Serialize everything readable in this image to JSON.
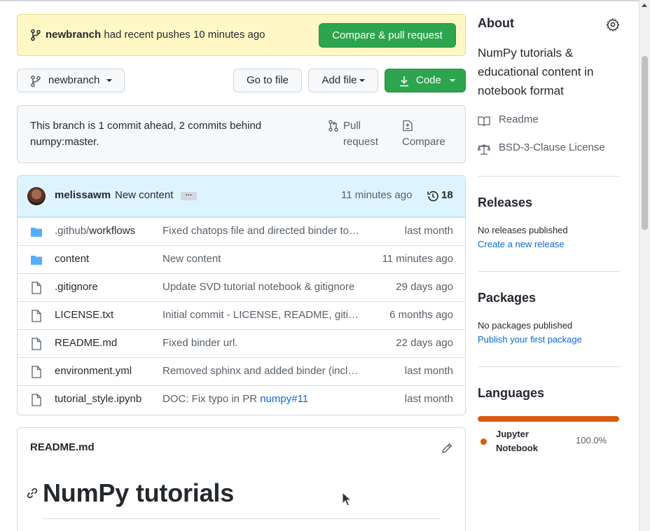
{
  "flash": {
    "branch": "newbranch",
    "message": "had recent pushes 10 minutes ago",
    "compare_button": "Compare & pull request"
  },
  "toolbar": {
    "branch_select": "newbranch",
    "go_to_file": "Go to file",
    "add_file": "Add file",
    "code": "Code"
  },
  "ahead_behind": {
    "text": "This branch is 1 commit ahead, 2 commits behind numpy:master.",
    "pull_request": "Pull request",
    "compare": "Compare"
  },
  "latest_commit": {
    "author": "melissawm",
    "message": "New content",
    "time": "11 minutes ago",
    "commit_count": "18"
  },
  "files": [
    {
      "type": "folder",
      "name_prefix": ".github/",
      "name": "workflows",
      "message": "Fixed chatops file and directed binder to…",
      "age": "last month"
    },
    {
      "type": "folder",
      "name_prefix": "",
      "name": "content",
      "message": "New content",
      "age": "11 minutes ago"
    },
    {
      "type": "file",
      "name_prefix": "",
      "name": ".gitignore",
      "message": "Update SVD tutorial notebook & gitignore",
      "age": "29 days ago"
    },
    {
      "type": "file",
      "name_prefix": "",
      "name": "LICENSE.txt",
      "message": "Initial commit - LICENSE, README, giti…",
      "age": "6 months ago"
    },
    {
      "type": "file",
      "name_prefix": "",
      "name": "README.md",
      "message": "Fixed binder url.",
      "age": "22 days ago"
    },
    {
      "type": "file",
      "name_prefix": "",
      "name": "environment.yml",
      "message": "Removed sphinx and added binder (incl…",
      "age": "last month"
    },
    {
      "type": "file",
      "name_prefix": "",
      "name": "tutorial_style.ipynb",
      "message": "DOC: Fix typo in PR ",
      "message_link": "numpy#11",
      "age": "last month"
    }
  ],
  "readme": {
    "title": "README.md",
    "heading": "NumPy tutorials"
  },
  "about": {
    "title": "About",
    "description": "NumPy tutorials & educational content in notebook format",
    "readme_link": "Readme",
    "license_link": "BSD-3-Clause License"
  },
  "releases": {
    "title": "Releases",
    "status": "No releases published",
    "link": "Create a new release"
  },
  "packages": {
    "title": "Packages",
    "status": "No packages published",
    "link": "Publish your first package"
  },
  "languages": {
    "title": "Languages",
    "items": [
      {
        "name": "Jupyter Notebook",
        "percent": "100.0%",
        "color": "#da5b0b"
      }
    ]
  },
  "colors": {
    "accent_green": "#2da44e",
    "link_blue": "#0969da",
    "flash_bg": "#fff8c5"
  }
}
